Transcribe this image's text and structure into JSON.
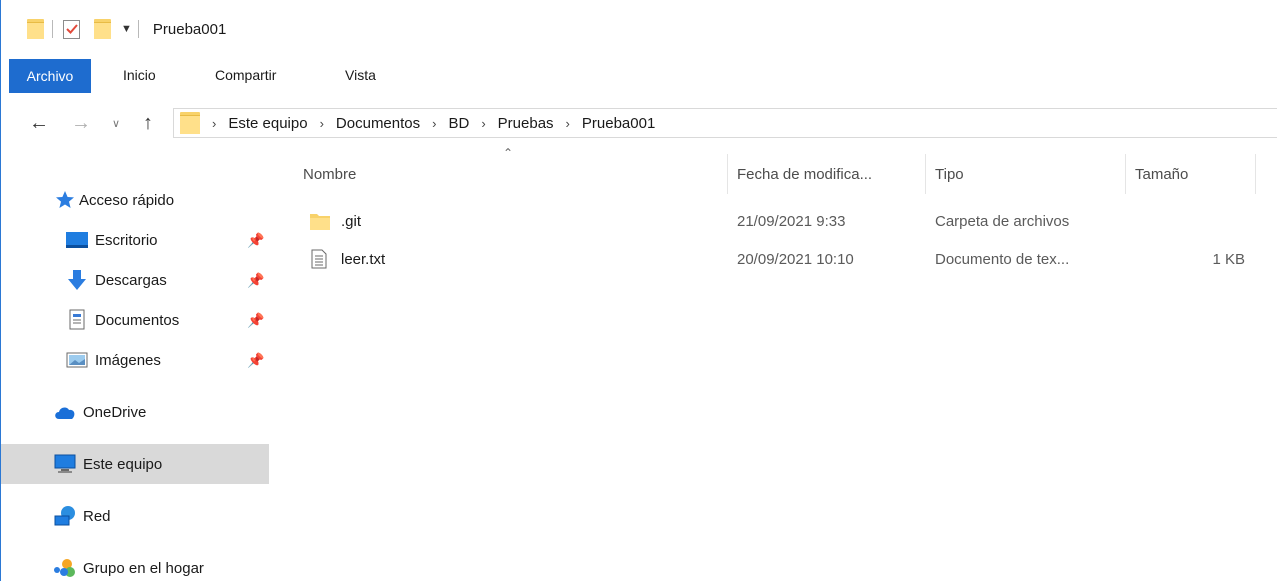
{
  "window": {
    "title": "Prueba001"
  },
  "ribbon": {
    "tabs": [
      {
        "label": "Archivo",
        "active": true
      },
      {
        "label": "Inicio"
      },
      {
        "label": "Compartir"
      },
      {
        "label": "Vista"
      }
    ]
  },
  "address": {
    "breadcrumbs": [
      "Este equipo",
      "Documentos",
      "BD",
      "Pruebas",
      "Prueba001"
    ]
  },
  "navpane": {
    "quick_access": "Acceso rápido",
    "items": [
      {
        "label": "Escritorio",
        "icon": "desktop-icon",
        "pinned": true
      },
      {
        "label": "Descargas",
        "icon": "downloads-icon",
        "pinned": true
      },
      {
        "label": "Documentos",
        "icon": "documents-icon",
        "pinned": true
      },
      {
        "label": "Imágenes",
        "icon": "pictures-icon",
        "pinned": true
      }
    ],
    "onedrive": "OneDrive",
    "this_pc": "Este equipo",
    "network": "Red",
    "homegroup": "Grupo en el hogar"
  },
  "columns": {
    "name": "Nombre",
    "modified": "Fecha de modifica...",
    "type": "Tipo",
    "size": "Tamaño"
  },
  "files": [
    {
      "name": ".git",
      "modified": "21/09/2021 9:33",
      "type": "Carpeta de archivos",
      "size": "",
      "icon": "folder-icon"
    },
    {
      "name": "leer.txt",
      "modified": "20/09/2021 10:10",
      "type": "Documento de tex...",
      "size": "1 KB",
      "icon": "text-file-icon"
    }
  ],
  "colors": {
    "accent": "#1e6ccf",
    "selected_bg": "#d9d9d9",
    "folder": "#ffe08a"
  }
}
